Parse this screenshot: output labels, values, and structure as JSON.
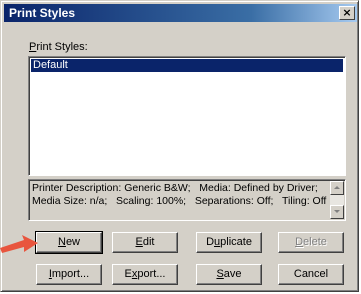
{
  "window": {
    "title": "Print Styles",
    "close_glyph": "×"
  },
  "list": {
    "label": "Print Styles:",
    "label_mnemonic": "P",
    "label_rest": "rint Styles:",
    "items": [
      {
        "label": "Default",
        "selected": true
      }
    ]
  },
  "description": {
    "line1": "Printer Description: Generic B&W;   Media: Defined by Driver;",
    "line2": "Media Size: n/a;   Scaling: 100%;   Separations: Off;   Tiling: Off"
  },
  "buttons": {
    "new": {
      "mnemonic": "N",
      "rest": "ew"
    },
    "edit": {
      "mnemonic": "E",
      "rest": "dit"
    },
    "duplicate": {
      "pre": "D",
      "mnemonic": "u",
      "rest": "plicate"
    },
    "delete": {
      "mnemonic": "D",
      "rest": "elete",
      "enabled": false
    },
    "import": {
      "mnemonic": "I",
      "rest": "mport..."
    },
    "export": {
      "pre": "E",
      "mnemonic": "x",
      "rest": "port..."
    },
    "save": {
      "mnemonic": "S",
      "rest": "ave"
    },
    "cancel": {
      "label": "Cancel"
    }
  },
  "colors": {
    "titlebar": "#0a246a",
    "dialog_bg": "#d4d0c8",
    "selection": "#0a246a",
    "annotation_arrow": "#e8553e"
  },
  "annotation": {
    "icon": "arrow-right-icon"
  }
}
